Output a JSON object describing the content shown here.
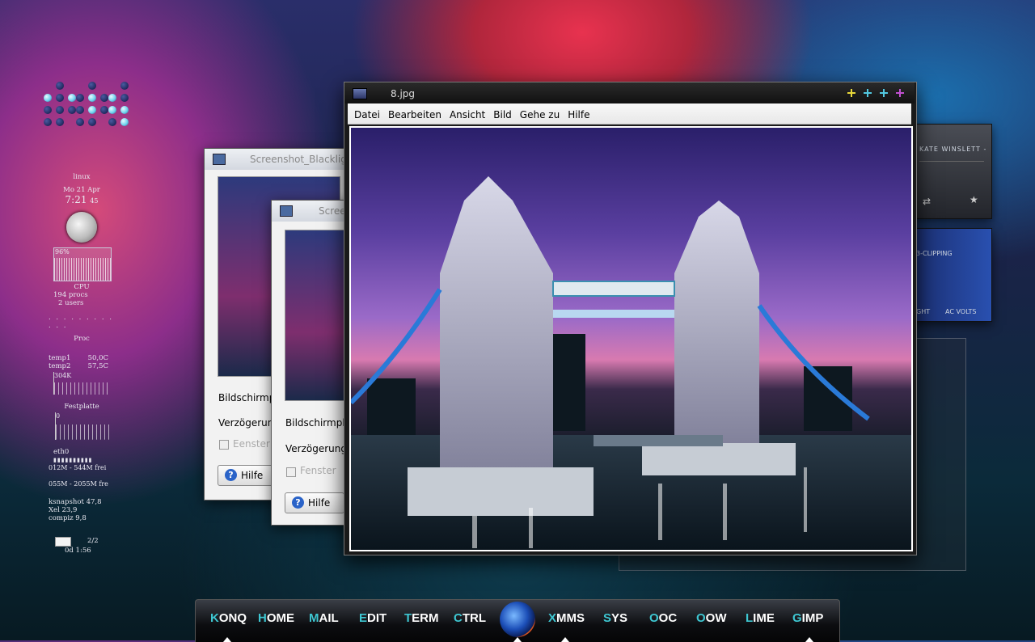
{
  "desktop": {
    "monitor": {
      "hostname": "linux",
      "date": "Mo 21 Apr",
      "time": "7:21",
      "seconds": "45",
      "cpu_percent": "96%",
      "cpu_label": "CPU",
      "procs": "194 procs",
      "users": "2 users",
      "proc_label": "Proc",
      "temp1_label": "temp1",
      "temp1_value": "50,0C",
      "temp2_label": "temp2",
      "temp2_value": "57,5C",
      "net_rate": "304K",
      "disk_label": "Festplatte",
      "disk_value": "0",
      "eth_label": "eth0",
      "mem1": "012M - 544M frei",
      "mem2": "055M - 2055M fre",
      "top1": "ksnapshot 47,8",
      "top2": "Xel 23,9",
      "top3": "compiz 9,8",
      "mail_count": "2/2",
      "uptime": "0d  1:56"
    }
  },
  "bg_window_1": {
    "title": "Screenshot_Blacklig",
    "label_a": "Bildschirmph",
    "label_b": "Verzögerung",
    "checkbox_label": "Eenster",
    "help_label": "Hilfe"
  },
  "bg_window_2": {
    "title": "Scree",
    "label_a": "Bildschirmph",
    "label_b": "Verzögerung",
    "checkbox_label": "Fenster",
    "help_label": "Hilfe"
  },
  "xmms": {
    "track": "KATE WINSLETT -",
    "eq_label": "3-CLIPPING",
    "eq_left": "GHT",
    "eq_right": "AC VOLTS"
  },
  "image_viewer": {
    "title": "8.jpg",
    "menu": [
      "Datei",
      "Bearbeiten",
      "Ansicht",
      "Bild",
      "Gehe zu",
      "Hilfe"
    ],
    "button_colors": [
      "#e8d83a",
      "#52c8e0",
      "#52c8e0",
      "#c050d0"
    ]
  },
  "dock": {
    "items": [
      {
        "first": "K",
        "rest": "ONQ"
      },
      {
        "first": "H",
        "rest": "OME"
      },
      {
        "first": "M",
        "rest": "AIL"
      },
      {
        "first": "E",
        "rest": "DIT"
      },
      {
        "first": "T",
        "rest": "ERM"
      },
      {
        "first": "C",
        "rest": "TRL"
      },
      {
        "first": "X",
        "rest": "MMS"
      },
      {
        "first": "S",
        "rest": "YS"
      },
      {
        "first": "O",
        "rest": "OC"
      },
      {
        "first": "O",
        "rest": "OW"
      },
      {
        "first": "L",
        "rest": "IME"
      },
      {
        "first": "G",
        "rest": "IMP"
      }
    ]
  }
}
